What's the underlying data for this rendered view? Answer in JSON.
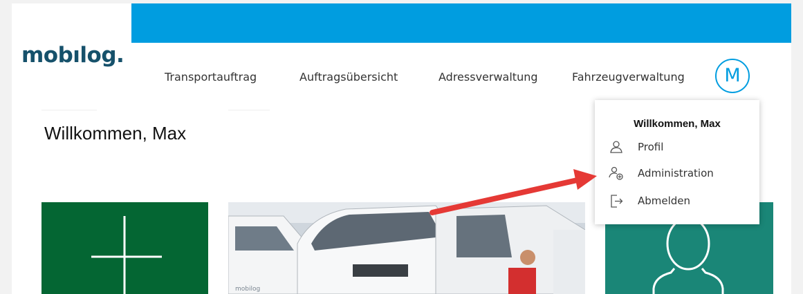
{
  "app": {
    "logo_text": "mobılog."
  },
  "nav": {
    "items": [
      {
        "label": "Transportauftrag"
      },
      {
        "label": "Auftragsübersicht"
      },
      {
        "label": "Adressverwaltung"
      },
      {
        "label": "Fahrzeugverwaltung"
      }
    ]
  },
  "user": {
    "avatar_letter": "M"
  },
  "main": {
    "welcome": "Willkommen, Max"
  },
  "user_menu": {
    "title": "Willkommen, Max",
    "items": [
      {
        "label": "Profil",
        "icon": "person-icon"
      },
      {
        "label": "Administration",
        "icon": "admin-user-icon"
      },
      {
        "label": "Abmelden",
        "icon": "logout-icon"
      }
    ]
  },
  "colors": {
    "top_bar": "#009de0",
    "logo": "#16516b",
    "tile_new": "#046633",
    "tile_user": "#1a8677",
    "annotation_arrow": "#e53935"
  }
}
